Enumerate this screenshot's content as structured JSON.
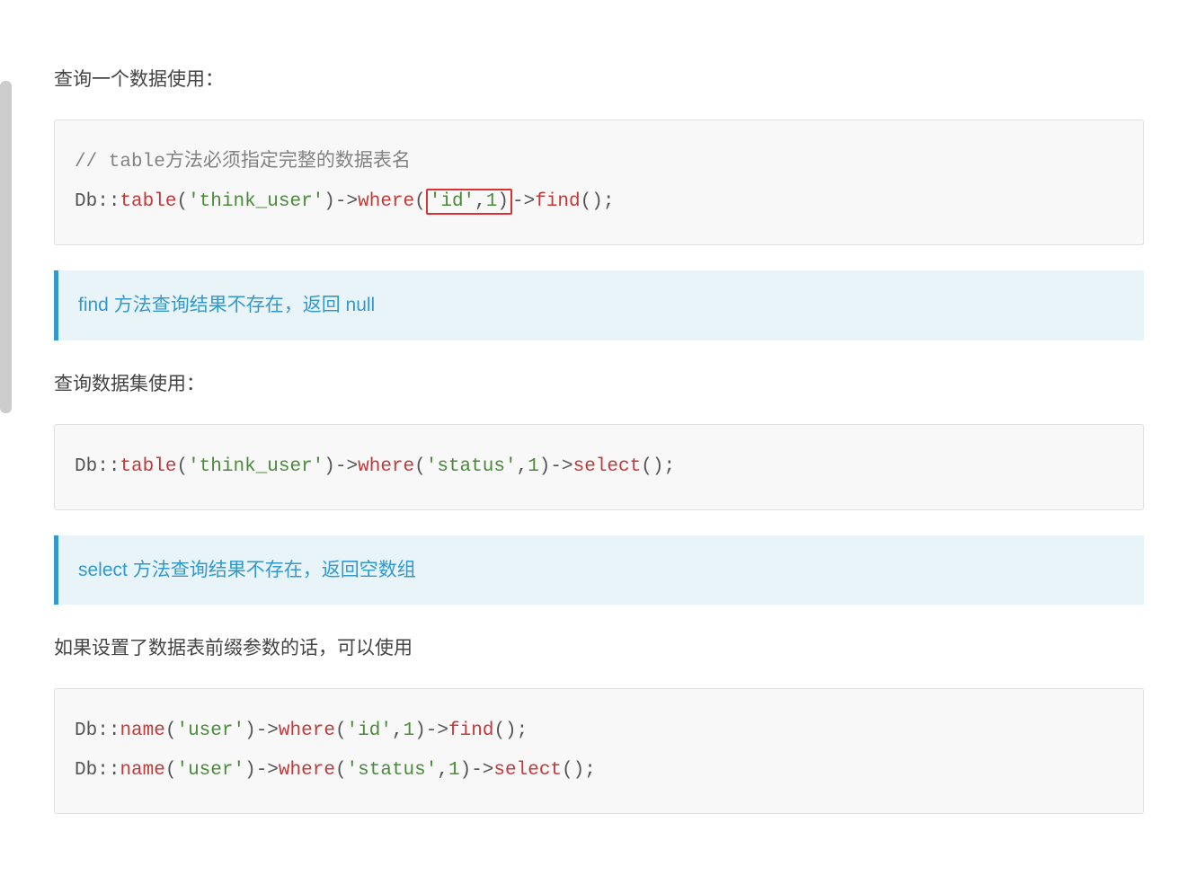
{
  "section1": {
    "intro": "查询一个数据使用：",
    "code_comment": "// table方法必须指定完整的数据表名",
    "code": {
      "class": "Db",
      "method1": "table",
      "arg1": "'think_user'",
      "method2": "where",
      "arg2a": "'id'",
      "arg2b": "1",
      "method3": "find"
    },
    "note": "find 方法查询结果不存在，返回 null"
  },
  "section2": {
    "intro": "查询数据集使用：",
    "code": {
      "class": "Db",
      "method1": "table",
      "arg1": "'think_user'",
      "method2": "where",
      "arg2a": "'status'",
      "arg2b": "1",
      "method3": "select"
    },
    "note": "select 方法查询结果不存在，返回空数组"
  },
  "section3": {
    "intro": "如果设置了数据表前缀参数的话，可以使用",
    "code_line1": {
      "class": "Db",
      "method1": "name",
      "arg1": "'user'",
      "method2": "where",
      "arg2a": "'id'",
      "arg2b": "1",
      "method3": "find"
    },
    "code_line2": {
      "class": "Db",
      "method1": "name",
      "arg1": "'user'",
      "method2": "where",
      "arg2a": "'status'",
      "arg2b": "1",
      "method3": "select"
    }
  }
}
